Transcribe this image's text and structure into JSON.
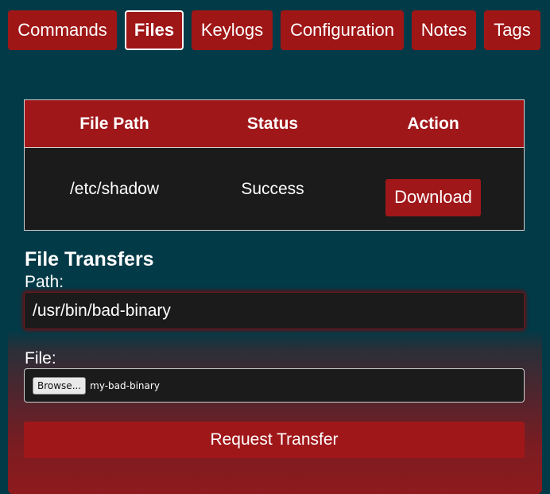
{
  "tabs": [
    {
      "label": "Commands",
      "active": false
    },
    {
      "label": "Files",
      "active": true
    },
    {
      "label": "Keylogs",
      "active": false
    },
    {
      "label": "Configuration",
      "active": false
    },
    {
      "label": "Notes",
      "active": false
    },
    {
      "label": "Tags",
      "active": false
    }
  ],
  "files_table": {
    "headers": [
      "File Path",
      "Status",
      "Action"
    ],
    "rows": [
      {
        "path": "/etc/shadow",
        "status": "Success",
        "action_label": "Download"
      }
    ]
  },
  "transfer_form": {
    "title": "File Transfers",
    "path_label": "Path:",
    "path_value": "/usr/bin/bad-binary",
    "file_label": "File:",
    "browse_label": "Browse...",
    "file_name": "my-bad-binary",
    "submit_label": "Request Transfer"
  },
  "colors": {
    "background": "#023a47",
    "accent_red": "#a0171a",
    "panel_dark": "#1b1b1b"
  }
}
